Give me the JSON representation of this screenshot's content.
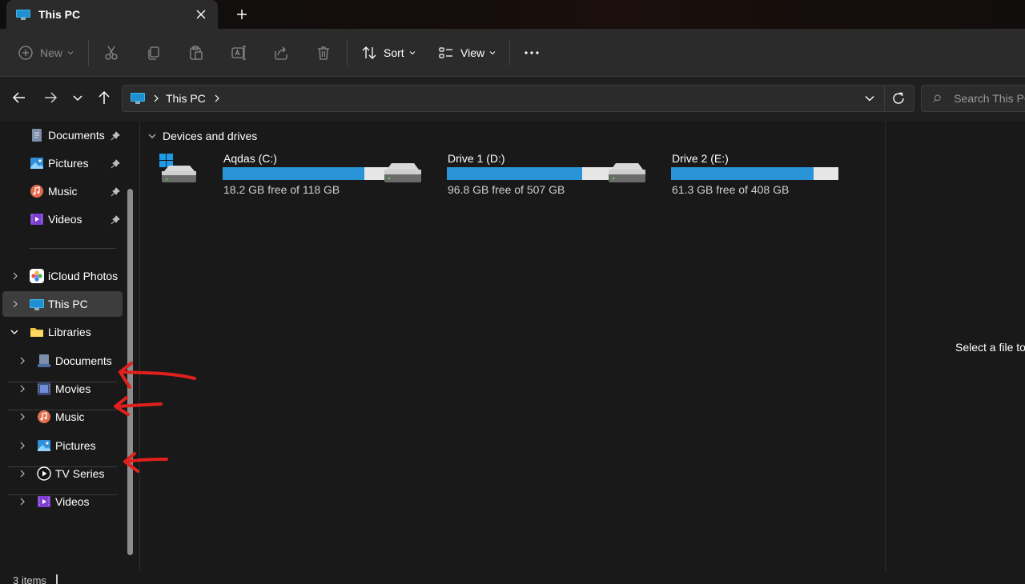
{
  "window": {
    "tab_title": "This PC"
  },
  "toolbar": {
    "new_label": "New",
    "sort_label": "Sort",
    "view_label": "View"
  },
  "address": {
    "crumb": "This PC"
  },
  "search": {
    "placeholder": "Search This PC"
  },
  "sidebar": {
    "quick_access": [
      {
        "label": "Documents",
        "icon": "documents-icon"
      },
      {
        "label": "Pictures",
        "icon": "pictures-icon"
      },
      {
        "label": "Music",
        "icon": "music-icon"
      },
      {
        "label": "Videos",
        "icon": "videos-icon"
      }
    ],
    "icloud": "iCloud Photos",
    "this_pc": "This PC",
    "libraries": "Libraries",
    "library_items": [
      {
        "label": "Documents",
        "icon": "documents-library-icon"
      },
      {
        "label": "Movies",
        "icon": "movies-icon"
      },
      {
        "label": "Music",
        "icon": "music-library-icon"
      },
      {
        "label": "Pictures",
        "icon": "pictures-library-icon"
      },
      {
        "label": "TV Series",
        "icon": "tv-series-icon"
      },
      {
        "label": "Videos",
        "icon": "videos-library-icon"
      }
    ]
  },
  "content": {
    "group_header": "Devices and drives",
    "drives": [
      {
        "name": "Aqdas (C:)",
        "free_text": "18.2 GB free of 118 GB",
        "used_fraction": 0.846,
        "system": true
      },
      {
        "name": "Drive 1 (D:)",
        "free_text": "96.8 GB free of 507 GB",
        "used_fraction": 0.809,
        "system": false
      },
      {
        "name": "Drive 2 (E:)",
        "free_text": "61.3 GB free of 408 GB",
        "used_fraction": 0.85,
        "system": false
      }
    ]
  },
  "details": {
    "message": "Select a file to preview."
  },
  "status": {
    "items": "3 items"
  },
  "colors": {
    "accent": "#2a94d8",
    "annotation": "#e0201c"
  }
}
